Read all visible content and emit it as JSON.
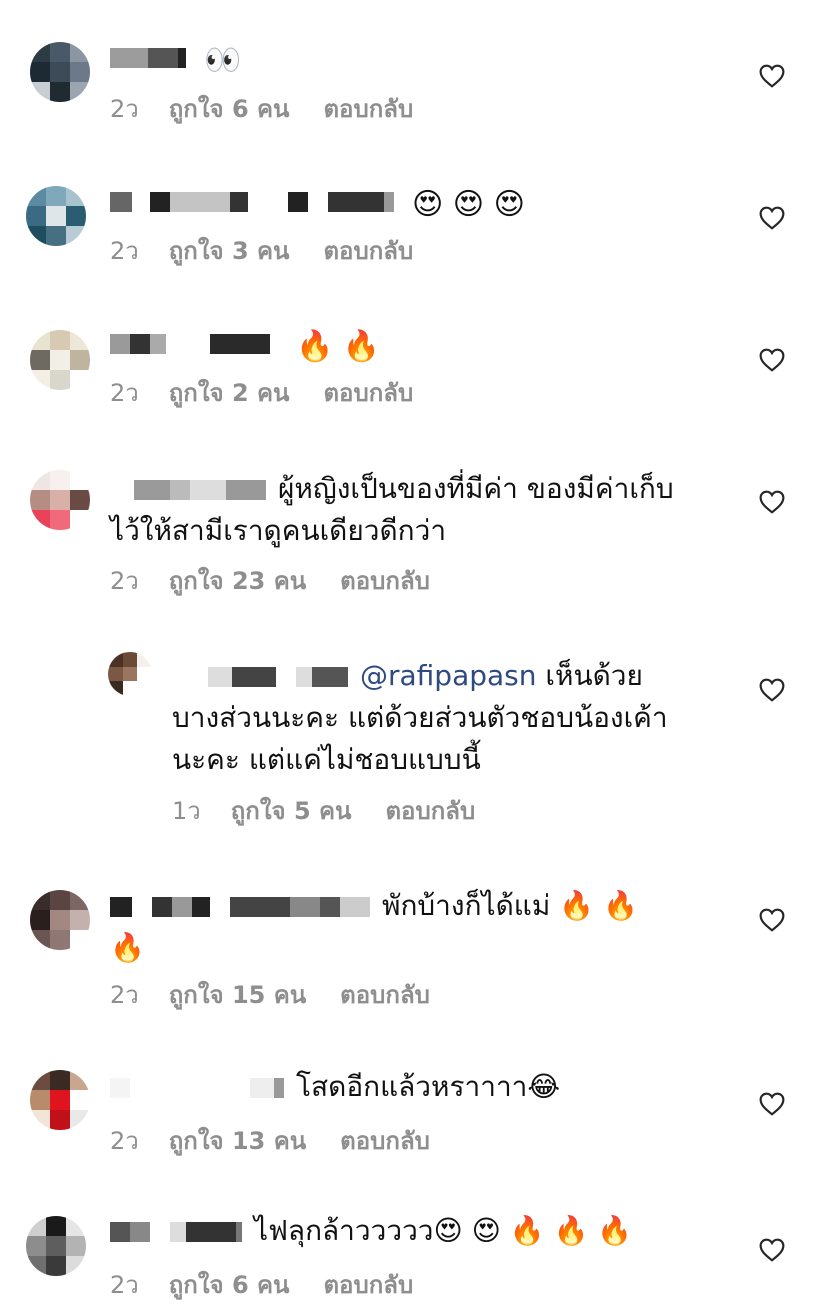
{
  "comments": [
    {
      "text": "👀",
      "time": "2ว",
      "likes": "ถูกใจ 6 คน",
      "reply": "ตอบกลับ"
    },
    {
      "text": "😍 😍 😍",
      "time": "2ว",
      "likes": "ถูกใจ 3 คน",
      "reply": "ตอบกลับ"
    },
    {
      "text": "🔥 🔥",
      "time": "2ว",
      "likes": "ถูกใจ 2 คน",
      "reply": "ตอบกลับ"
    },
    {
      "text_line1": "ผู้หญิงเป็นของที่มีค่า  ของมีค่าเก็บ",
      "text_line2": "ไว้ให้สามีเราดูคนเดียวดีกว่า",
      "time": "2ว",
      "likes": "ถูกใจ 23 คน",
      "reply": "ตอบกลับ"
    },
    {
      "mention": "@rafipapasn",
      "text_line1": " เห็นด้วย",
      "text_line2": "บางส่วนนะคะ แต่ด้วยส่วนตัวชอบน้องเค้า",
      "text_line3": "นะคะ แต่แค่ไม่ชอบแบบนี้",
      "time": "1ว",
      "likes": "ถูกใจ 5 คน",
      "reply": "ตอบกลับ"
    },
    {
      "text_line1": "พักบ้างก็ได้แม่ 🔥 🔥",
      "text_line2": "🔥",
      "time": "2ว",
      "likes": "ถูกใจ 15 คน",
      "reply": "ตอบกลับ"
    },
    {
      "text": "โสดอีกแล้วหราาาา😂",
      "time": "2ว",
      "likes": "ถูกใจ 13 คน",
      "reply": "ตอบกลับ"
    },
    {
      "text": "ไฟลุกล้าววววว😍 😍 🔥 🔥 🔥",
      "time": "2ว",
      "likes": "ถูกใจ 6 คน",
      "reply": "ตอบกลับ"
    }
  ],
  "colors": {
    "meta_gray": "#8e8e8e",
    "mention_blue": "#2e4a80",
    "text": "#111111"
  },
  "icons": {
    "like": "heart-outline-icon"
  }
}
